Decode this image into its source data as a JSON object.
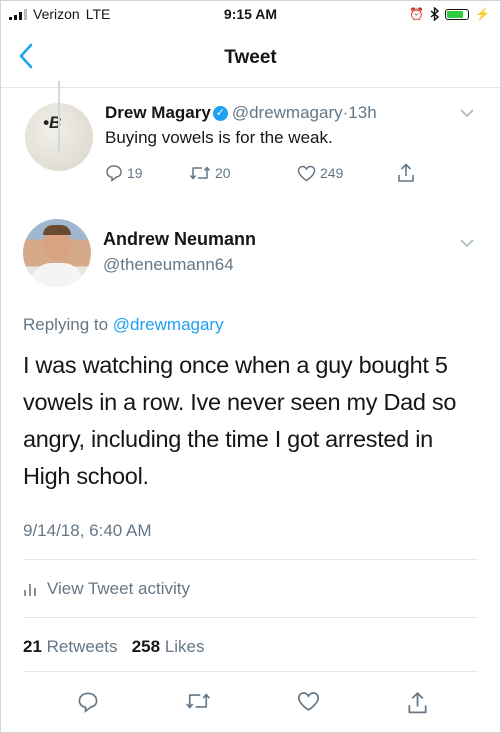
{
  "status_bar": {
    "carrier": "Verizon",
    "network": "LTE",
    "time": "9:15 AM"
  },
  "nav": {
    "title": "Tweet"
  },
  "parent_tweet": {
    "author_name": "Drew Magary",
    "handle": "@drewmagary",
    "separator": "·",
    "age": "13h",
    "avatar_text": "•B",
    "text": "Buying vowels is for the weak.",
    "replies": "19",
    "retweets": "20",
    "likes": "249"
  },
  "tweet": {
    "author_name": "Andrew Neumann",
    "handle": "@theneumann64",
    "replying_prefix": "Replying to",
    "replying_to": "@drewmagary",
    "text": "I was watching once when a guy bought 5 vowels in a row. Ive never seen my Dad so angry, including the time I got arrested in High school.",
    "date": "9/14/18, 6:40 AM",
    "activity_label": "View Tweet activity",
    "retweet_count": "21",
    "retweet_label": "Retweets",
    "like_count": "258",
    "like_label": "Likes"
  },
  "colors": {
    "accent": "#1da1f2",
    "muted": "#657786"
  }
}
